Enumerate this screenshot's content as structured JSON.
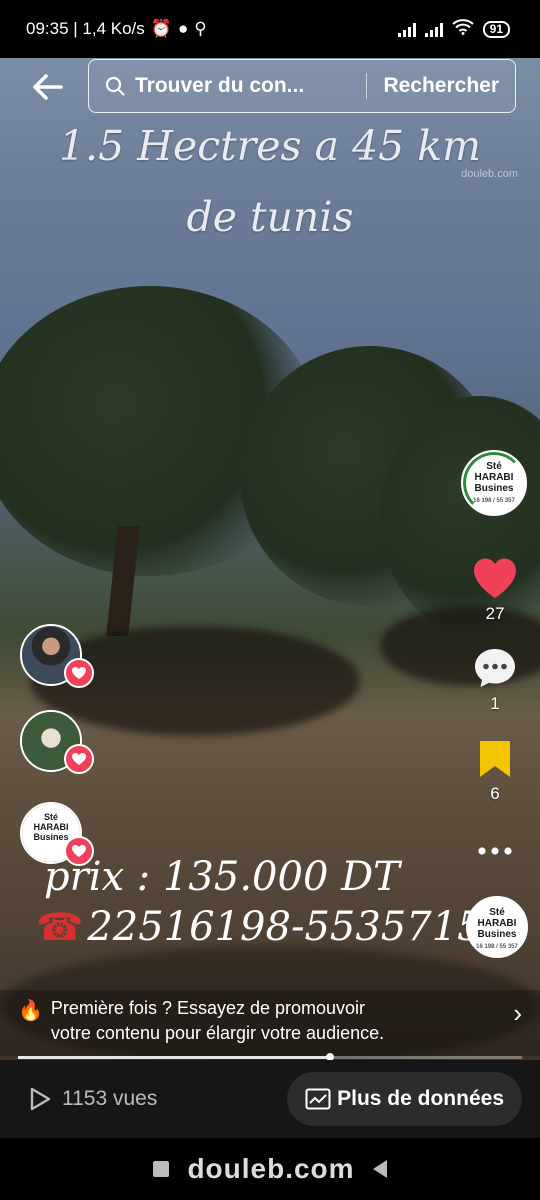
{
  "status_bar": {
    "time_speed": "09:35 | 1,4 Ko/s",
    "battery": "91"
  },
  "search": {
    "placeholder": "Trouver du con...",
    "button": "Rechercher"
  },
  "video": {
    "watermark": "douleb.com",
    "title_line1": "1.5 Hectres a 45 km",
    "title_line2": "de tunis",
    "price": "prix : 135.000 DT",
    "phone": "22516198-5535715"
  },
  "profile": {
    "name_line1": "Sté",
    "name_line2": "HARABI",
    "name_line3": "Busines",
    "phone_small": "16 198 / 55 357"
  },
  "actions": {
    "likes": "27",
    "comments": "1",
    "saves": "6"
  },
  "promo": {
    "text_line1": "Première fois ? Essayez de promouvoir",
    "text_line2": "votre contenu pour élargir votre audience.",
    "progress": 0.62
  },
  "bottom": {
    "views": "1153 vues",
    "more_data": "Plus de données"
  },
  "nav": {
    "watermark": "douleb.com"
  },
  "colors": {
    "heart": "#f0405a",
    "bookmark": "#f5c400"
  }
}
